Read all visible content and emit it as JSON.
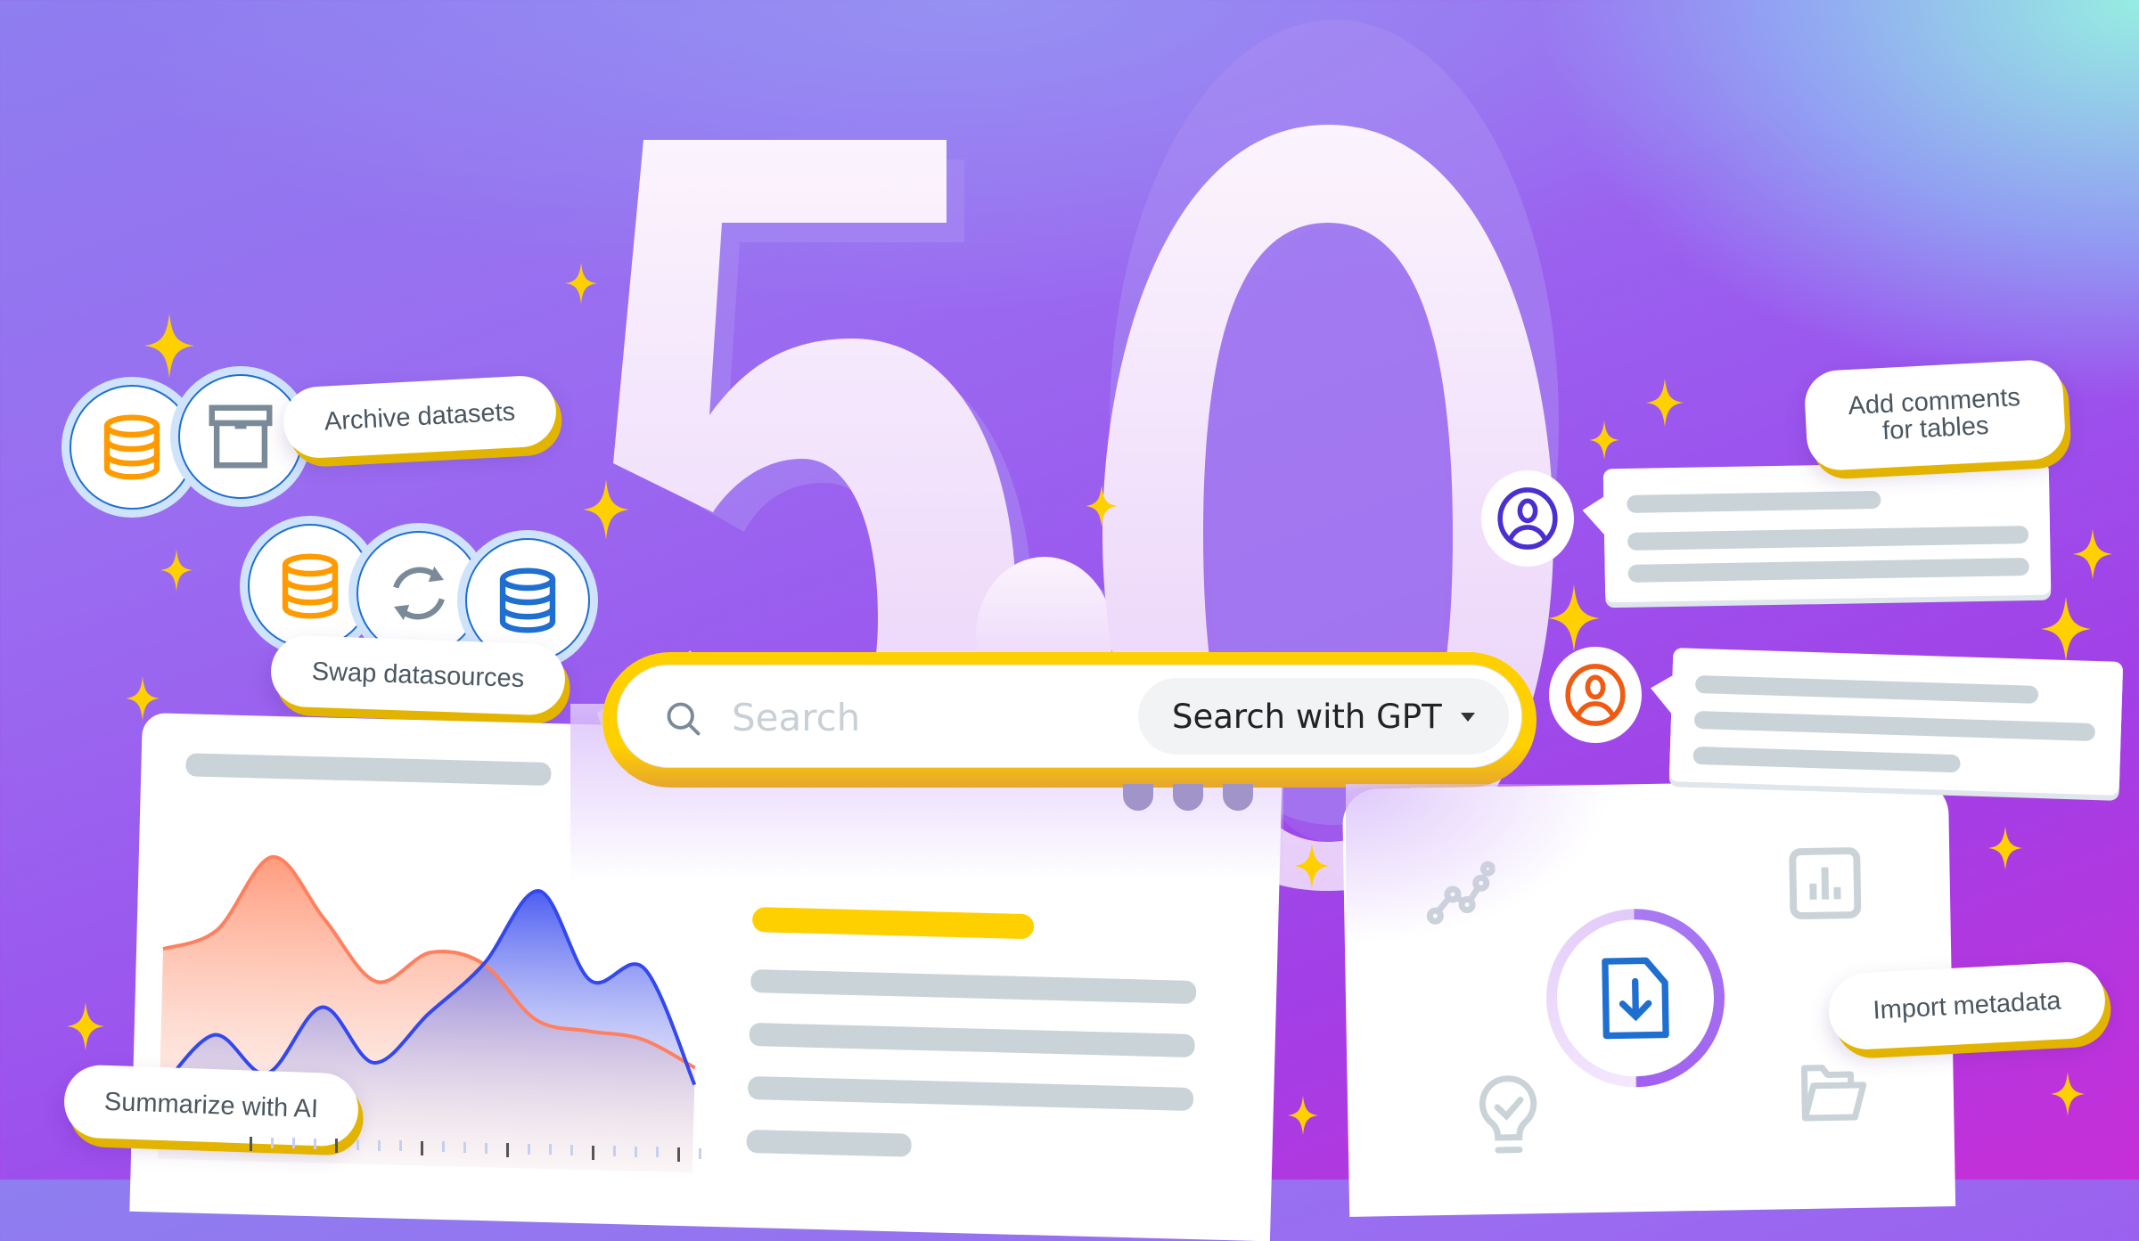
{
  "hero": {
    "version": "5.0"
  },
  "search": {
    "placeholder": "Search",
    "value": "",
    "mode_selected": "Search with GPT",
    "mode_dropdown_icon": "caret-down-icon",
    "search_icon": "magnifier-icon"
  },
  "features": {
    "archive": {
      "label": "Archive datasets",
      "icons": [
        "database-icon-orange",
        "archive-box-icon"
      ]
    },
    "swap": {
      "label": "Swap datasources",
      "icons": [
        "database-icon-orange",
        "refresh-icon",
        "database-icon-blue"
      ]
    },
    "comments": {
      "label_line1": "Add comments",
      "label_line2": "for tables",
      "avatars": [
        "user-avatar-purple",
        "user-avatar-orange"
      ]
    },
    "summarize": {
      "label": "Summarize with AI"
    },
    "import": {
      "label": "Import metadata",
      "icons": [
        "line-chart-icon",
        "bar-chart-icon",
        "file-download-icon",
        "lightbulb-check-icon",
        "folder-icon"
      ]
    }
  },
  "colors": {
    "accent_yellow": "#ffd000",
    "accent_shadow": "#e2b400",
    "orange_series": "#ff7f5e",
    "blue_series": "#3348ee",
    "placeholder_bar": "#c9d3d8",
    "avatar_purple": "#4b2fd0",
    "avatar_orange": "#f05a12",
    "db_orange": "#ff9a00",
    "db_blue": "#1e6fd0"
  },
  "chart_data": {
    "type": "area",
    "title": "",
    "xlabel": "",
    "ylabel": "",
    "grid": false,
    "x": [
      0,
      1,
      2,
      3,
      4,
      5,
      6,
      7,
      8,
      9,
      10
    ],
    "series": [
      {
        "name": "orange",
        "values": [
          62,
          68,
          90,
          72,
          54,
          63,
          60,
          44,
          41,
          39,
          31
        ]
      },
      {
        "name": "blue",
        "values": [
          20,
          37,
          26,
          46,
          30,
          45,
          60,
          82,
          56,
          60,
          26
        ]
      }
    ],
    "ylim": [
      0,
      100
    ]
  }
}
